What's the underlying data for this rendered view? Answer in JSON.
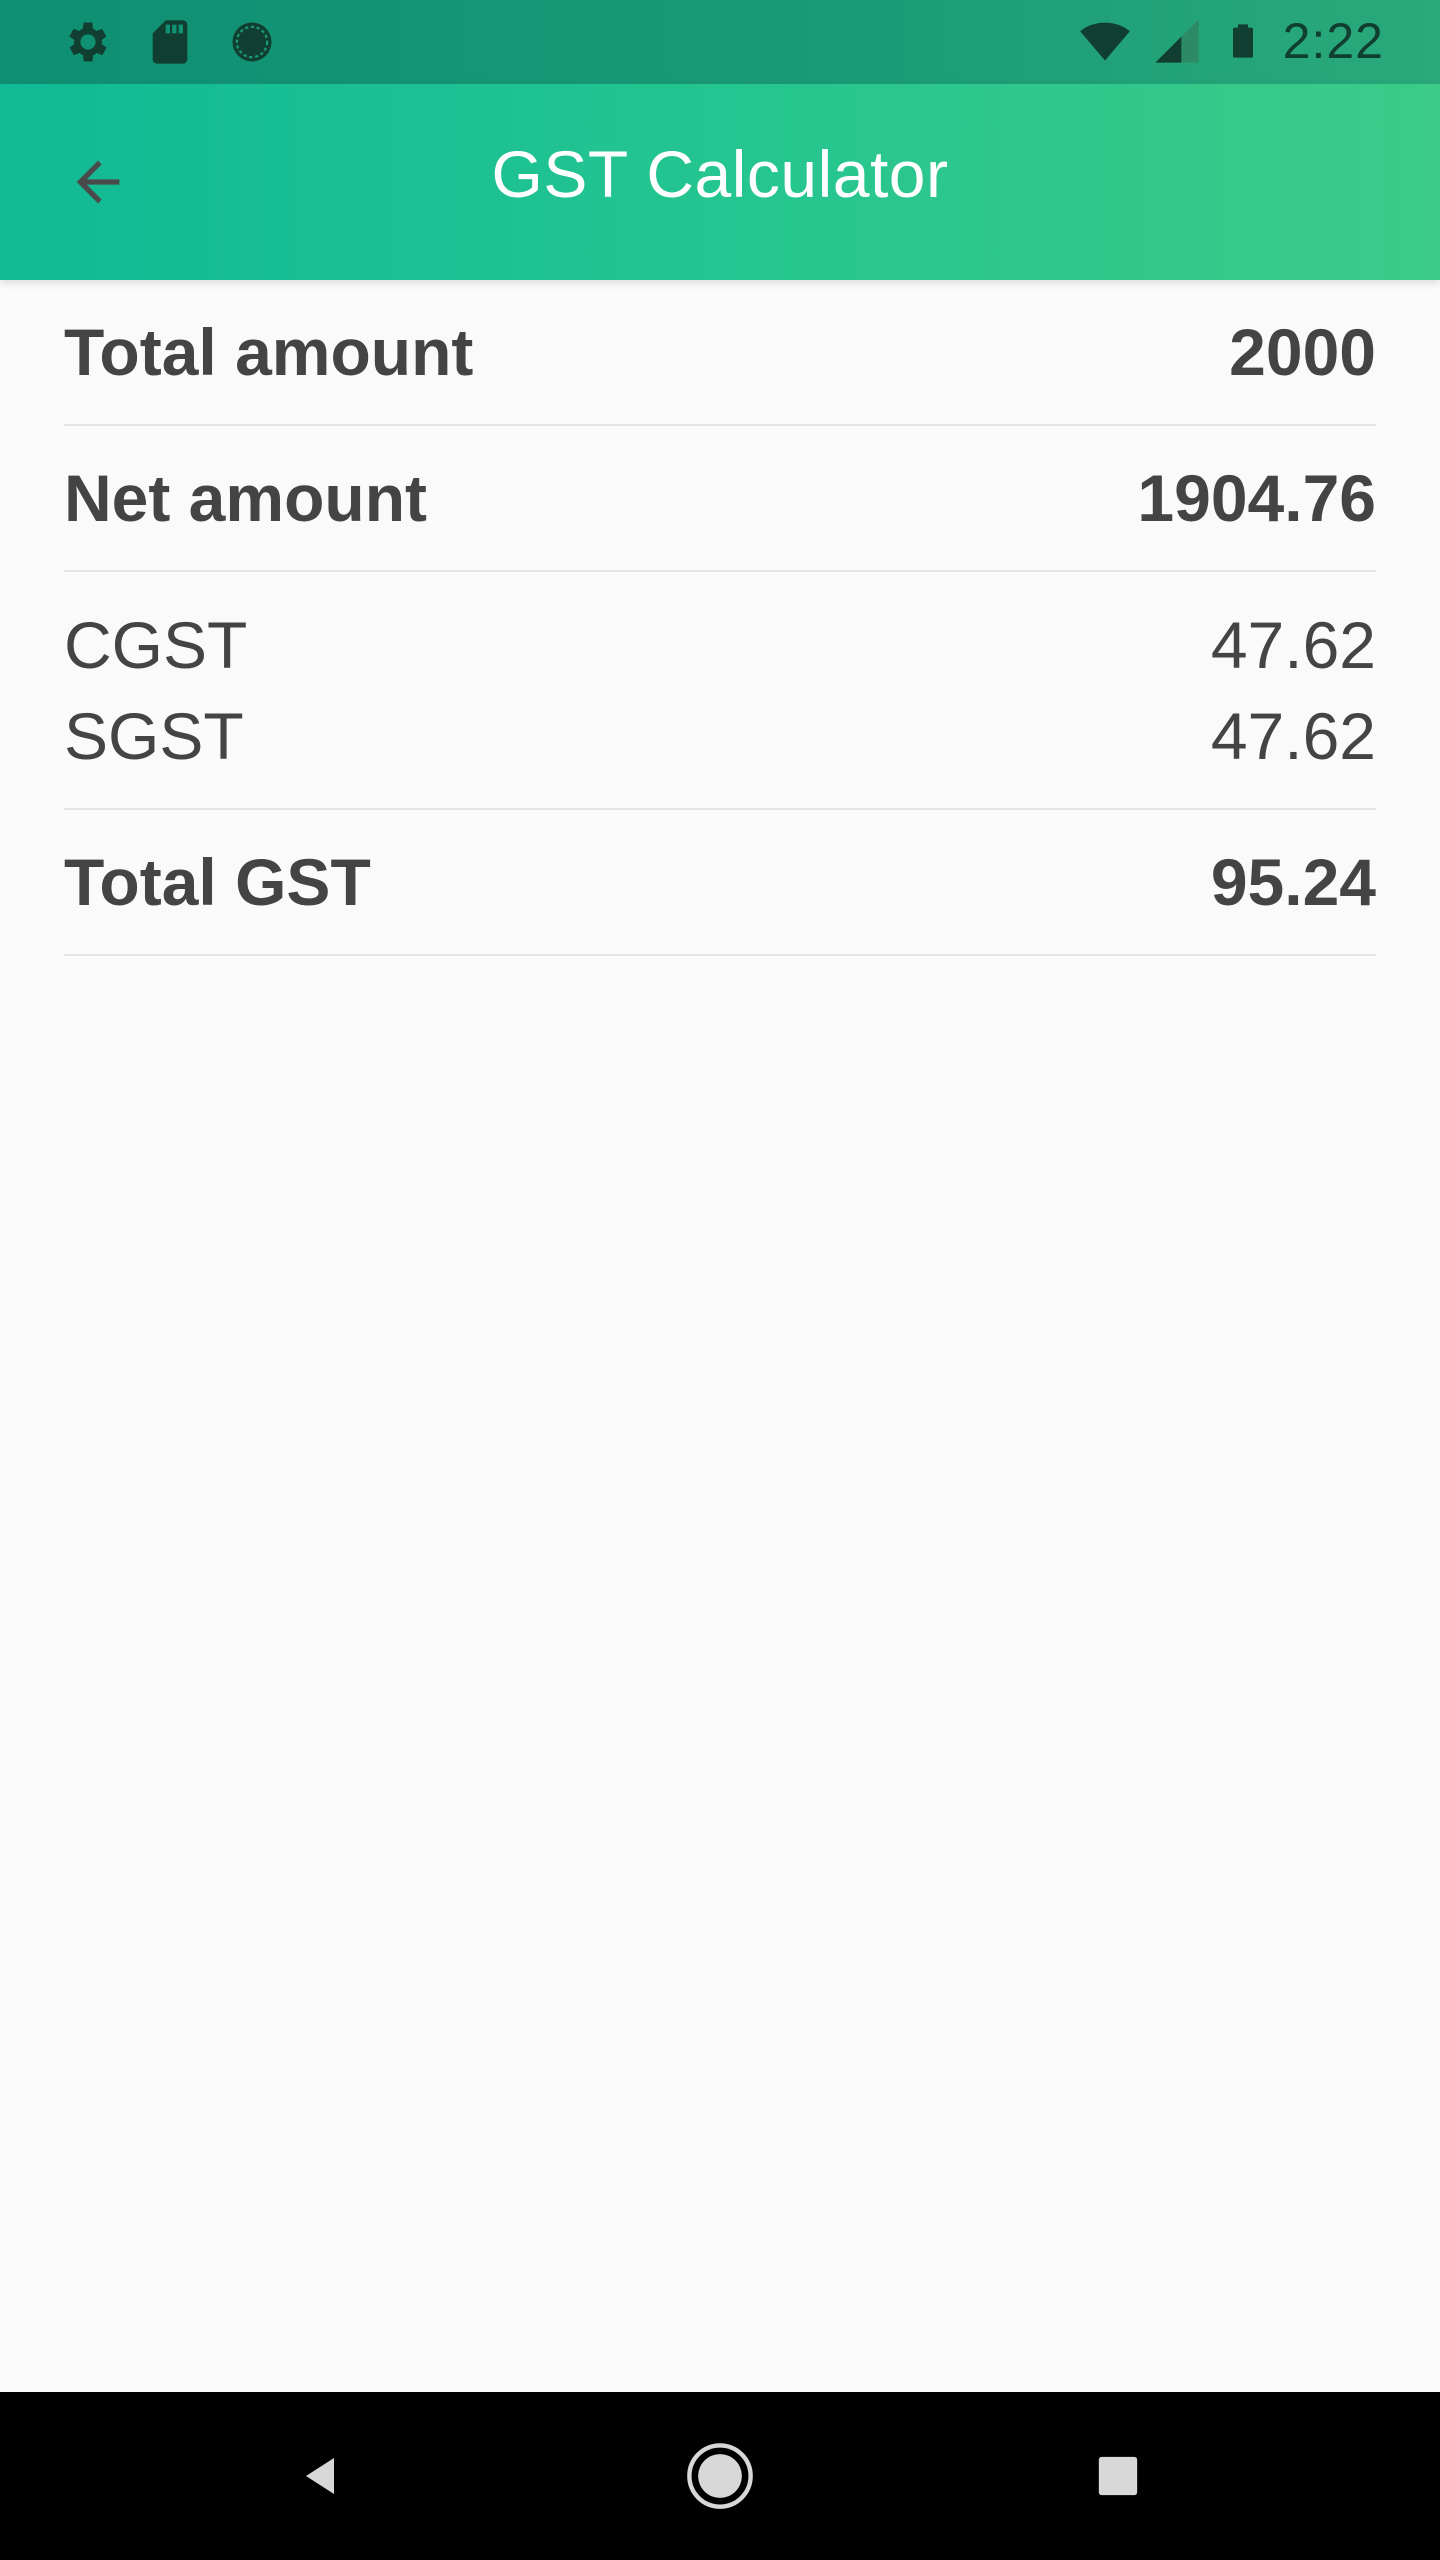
{
  "status_bar": {
    "time": "2:22",
    "left_icons": [
      "gear-icon",
      "sd-card-icon",
      "sync-icon"
    ],
    "right_icons": [
      "wifi-icon",
      "signal-icon",
      "battery-icon"
    ]
  },
  "app_bar": {
    "title": "GST Calculator",
    "back_icon": "arrow-back-icon"
  },
  "results": {
    "total_amount": {
      "label": "Total amount",
      "value": "2000"
    },
    "net_amount": {
      "label": "Net amount",
      "value": "1904.76"
    },
    "cgst": {
      "label": "CGST",
      "value": "47.62"
    },
    "sgst": {
      "label": "SGST",
      "value": "47.62"
    },
    "total_gst": {
      "label": "Total GST",
      "value": "95.24"
    }
  },
  "nav_bar": {
    "buttons": [
      "back-triangle-icon",
      "home-circle-icon",
      "recents-square-icon"
    ]
  },
  "colors": {
    "app_bar_start": "#11b995",
    "app_bar_end": "#3ccb88",
    "text": "#444444",
    "background": "#fafafa"
  }
}
